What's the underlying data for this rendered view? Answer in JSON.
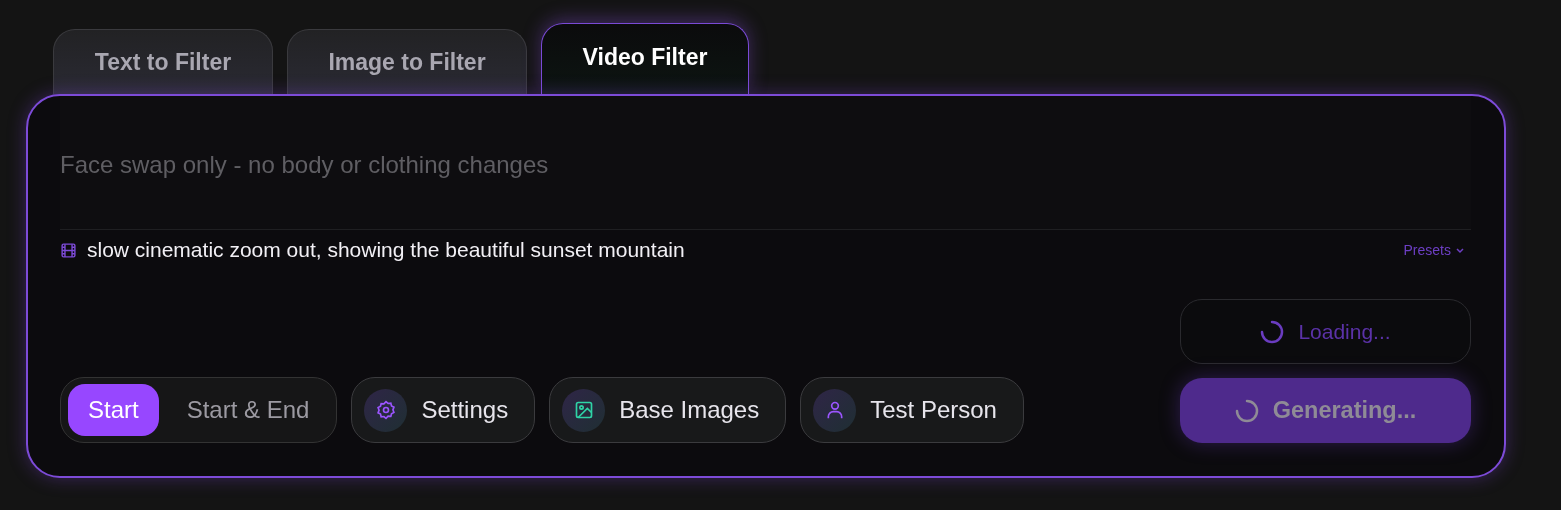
{
  "tabs": [
    {
      "label": "Text to Filter",
      "selected": false
    },
    {
      "label": "Image to Filter",
      "selected": false
    },
    {
      "label": "Video Filter",
      "selected": true
    }
  ],
  "prompt": {
    "placeholder": "Face swap only - no body or clothing changes"
  },
  "motion": {
    "text": "slow cinematic zoom out, showing the beautiful sunset mountain",
    "presets": "Presets"
  },
  "mode_toggle": [
    {
      "label": "Start",
      "selected": true
    },
    {
      "label": "Start & End",
      "selected": false
    }
  ],
  "actions": [
    {
      "label": "Settings",
      "kind": "settings"
    },
    {
      "label": "Base Images",
      "kind": "images"
    },
    {
      "label": "Test Person",
      "kind": "person"
    }
  ],
  "loading_button": {
    "label": "Loading..."
  },
  "generate_button": {
    "label": "Generating..."
  }
}
